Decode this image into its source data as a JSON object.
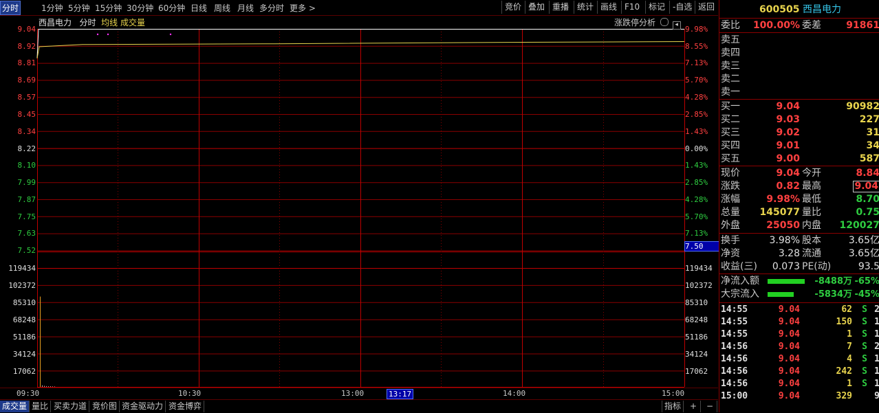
{
  "toolbar": {
    "periods": [
      "分时",
      "1分钟",
      "5分钟",
      "15分钟",
      "30分钟",
      "60分钟",
      "日线",
      "周线",
      "月线",
      "多分时",
      "更多 >"
    ],
    "active_period": "分时",
    "tools": [
      "竞价",
      "叠加",
      "重播",
      "统计",
      "画线",
      "F10",
      "标记",
      "-自选",
      "返回"
    ]
  },
  "chart": {
    "stock_name": "西昌电力",
    "mode": "分时",
    "avg_label": "均线",
    "vol_label": "成交量",
    "limit_analysis": "涨跌停分析",
    "price_labels": [
      "9.04",
      "8.92",
      "8.81",
      "8.69",
      "8.57",
      "8.45",
      "8.34",
      "8.22",
      "8.10",
      "7.99",
      "7.87",
      "7.75",
      "7.63",
      "7.52"
    ],
    "pct_labels": [
      "9.98%",
      "8.55%",
      "7.13%",
      "5.70%",
      "4.28%",
      "2.85%",
      "1.43%",
      "0.00%",
      "1.43%",
      "2.85%",
      "4.28%",
      "5.70%",
      "7.13%",
      ""
    ],
    "volume_labels": [
      "119434",
      "102372",
      "85310",
      "68248",
      "51186",
      "34124",
      "17062"
    ],
    "price_cursor": "7.50",
    "time_labels": [
      "09:30",
      "10:30",
      "13:00",
      "14:00",
      "15:00"
    ],
    "current_time": "13:17",
    "colors": {
      "up": "#ff4040",
      "down": "#2ecc40",
      "flat": "#e0e0e0",
      "price_line": "#ffffff",
      "avg_line": "#e8d44d",
      "grid": "#8b0000"
    }
  },
  "bottom_tabs": [
    "成交量",
    "量比",
    "买卖力道",
    "竞价图",
    "资金驱动力",
    "资金博弈"
  ],
  "bottom_right": [
    "指标",
    "+",
    "−"
  ],
  "panel": {
    "code": "600505",
    "name": "西昌电力",
    "weibi_label": "委比",
    "weibi_value": "100.00%",
    "weicha_label": "委差",
    "weicha_value": "91861",
    "sells": [
      {
        "label": "卖五",
        "price": "",
        "vol": ""
      },
      {
        "label": "卖四",
        "price": "",
        "vol": ""
      },
      {
        "label": "卖三",
        "price": "",
        "vol": ""
      },
      {
        "label": "卖二",
        "price": "",
        "vol": ""
      },
      {
        "label": "卖一",
        "price": "",
        "vol": ""
      }
    ],
    "buys": [
      {
        "label": "买一",
        "price": "9.04",
        "vol": "90982"
      },
      {
        "label": "买二",
        "price": "9.03",
        "vol": "227"
      },
      {
        "label": "买三",
        "price": "9.02",
        "vol": "31"
      },
      {
        "label": "买四",
        "price": "9.01",
        "vol": "34"
      },
      {
        "label": "买五",
        "price": "9.00",
        "vol": "587"
      }
    ],
    "quote": [
      {
        "l1": "现价",
        "v1": "9.04",
        "l2": "今开",
        "v2": "8.84"
      },
      {
        "l1": "涨跌",
        "v1": "0.82",
        "l2": "最高",
        "v2": "9.04"
      },
      {
        "l1": "涨幅",
        "v1": "9.98%",
        "l2": "最低",
        "v2": "8.70"
      },
      {
        "l1": "总量",
        "v1": "145077",
        "l2": "量比",
        "v2": "0.75"
      },
      {
        "l1": "外盘",
        "v1": "25050",
        "l2": "内盘",
        "v2": "120027"
      }
    ],
    "fundamentals": [
      {
        "l1": "换手",
        "v1": "3.98%",
        "l2": "股本",
        "v2": "3.65亿"
      },
      {
        "l1": "净资",
        "v1": "3.28",
        "l2": "流通",
        "v2": "3.65亿"
      },
      {
        "l1": "收益(三)",
        "v1": "0.073",
        "l2": "PE(动)",
        "v2": "93.5"
      }
    ],
    "flows": [
      {
        "label": "净流入额",
        "value": "-8488万",
        "pct": "-65%"
      },
      {
        "label": "大宗流入",
        "value": "-5834万",
        "pct": "-45%"
      }
    ],
    "ticks": [
      {
        "time": "14:55",
        "price": "9.04",
        "vol": "62",
        "bs": "S",
        "n": "2"
      },
      {
        "time": "14:55",
        "price": "9.04",
        "vol": "150",
        "bs": "S",
        "n": "1"
      },
      {
        "time": "14:55",
        "price": "9.04",
        "vol": "1",
        "bs": "S",
        "n": "1"
      },
      {
        "time": "14:56",
        "price": "9.04",
        "vol": "7",
        "bs": "S",
        "n": "2"
      },
      {
        "time": "14:56",
        "price": "9.04",
        "vol": "4",
        "bs": "S",
        "n": "1"
      },
      {
        "time": "14:56",
        "price": "9.04",
        "vol": "242",
        "bs": "S",
        "n": "1"
      },
      {
        "time": "14:56",
        "price": "9.04",
        "vol": "1",
        "bs": "S",
        "n": "1"
      },
      {
        "time": "15:00",
        "price": "9.04",
        "vol": "329",
        "bs": "",
        "n": "9"
      }
    ]
  }
}
